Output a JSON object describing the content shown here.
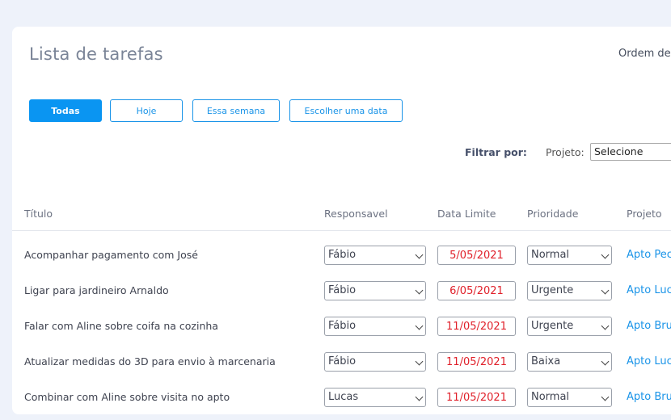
{
  "header": {
    "title": "Lista de tarefas",
    "order_label": "Ordem de"
  },
  "filters": {
    "tabs": [
      {
        "label": "Todas",
        "active": true
      },
      {
        "label": "Hoje",
        "active": false
      },
      {
        "label": "Essa semana",
        "active": false
      },
      {
        "label": "Escolher uma data",
        "active": false
      }
    ],
    "filter_label": "Filtrar por:",
    "projeto_label": "Projeto:",
    "projeto_value": "Selecione"
  },
  "table": {
    "columns": [
      "Título",
      "Responsavel",
      "Data Limite",
      "Prioridade",
      "Projeto"
    ],
    "rows": [
      {
        "titulo": "Acompanhar pagamento com José",
        "responsavel": "Fábio",
        "data": "5/05/2021",
        "prioridade": "Normal",
        "projeto": "Apto Pec"
      },
      {
        "titulo": "Ligar para jardineiro Arnaldo",
        "responsavel": "Fábio",
        "data": "6/05/2021",
        "prioridade": "Urgente",
        "projeto": "Apto Luc"
      },
      {
        "titulo": "Falar com Aline sobre coifa na cozinha",
        "responsavel": "Fábio",
        "data": "11/05/2021",
        "prioridade": "Urgente",
        "projeto": "Apto Bru"
      },
      {
        "titulo": "Atualizar medidas do 3D para envio à marcenaria",
        "responsavel": "Fábio",
        "data": "11/05/2021",
        "prioridade": "Baixa",
        "projeto": "Apto Luc"
      },
      {
        "titulo": "Combinar com Aline sobre visita no apto",
        "responsavel": "Lucas",
        "data": "11/05/2021",
        "prioridade": "Normal",
        "projeto": "Apto Bru"
      }
    ]
  },
  "colors": {
    "accent": "#0a95f2",
    "date_text": "#e0202a",
    "link": "#1a94e8"
  }
}
